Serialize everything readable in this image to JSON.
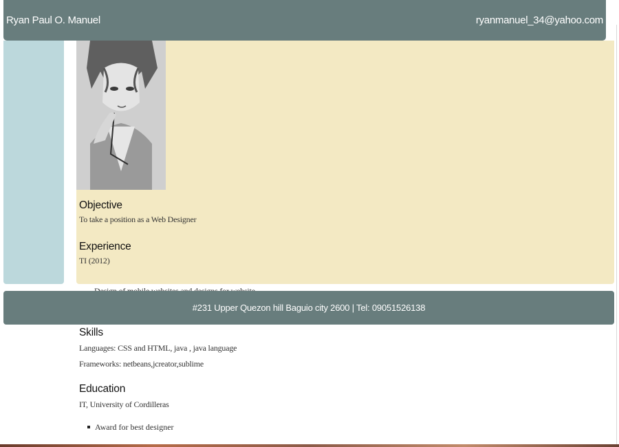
{
  "header": {
    "name": "Ryan Paul O. Manuel",
    "email": "ryanmanuel_34@yahoo.com"
  },
  "objective": {
    "title": "Objective",
    "text": "To take a position as a Web Designer"
  },
  "experience": {
    "title": "Experience",
    "entry": "TI (2012)",
    "partially_hidden_bullet": "Design of mobile websites and designs for website"
  },
  "footer": {
    "address": "#231 Upper Quezon hill Baguio city 2600 | Tel: 09051526138"
  },
  "skills": {
    "title": "Skills",
    "languages": "Languages: CSS and HTML, java , java language",
    "frameworks": "Frameworks: netbeans,jcreator,sublime"
  },
  "education": {
    "title": "Education",
    "entry": "IT, University of Cordilleras",
    "bullets": [
      "Award for best designer"
    ]
  },
  "colors": {
    "header_bg": "#687d7d",
    "sidebar_bg": "#bcd8dc",
    "panel_bg": "#f3e9c3"
  }
}
